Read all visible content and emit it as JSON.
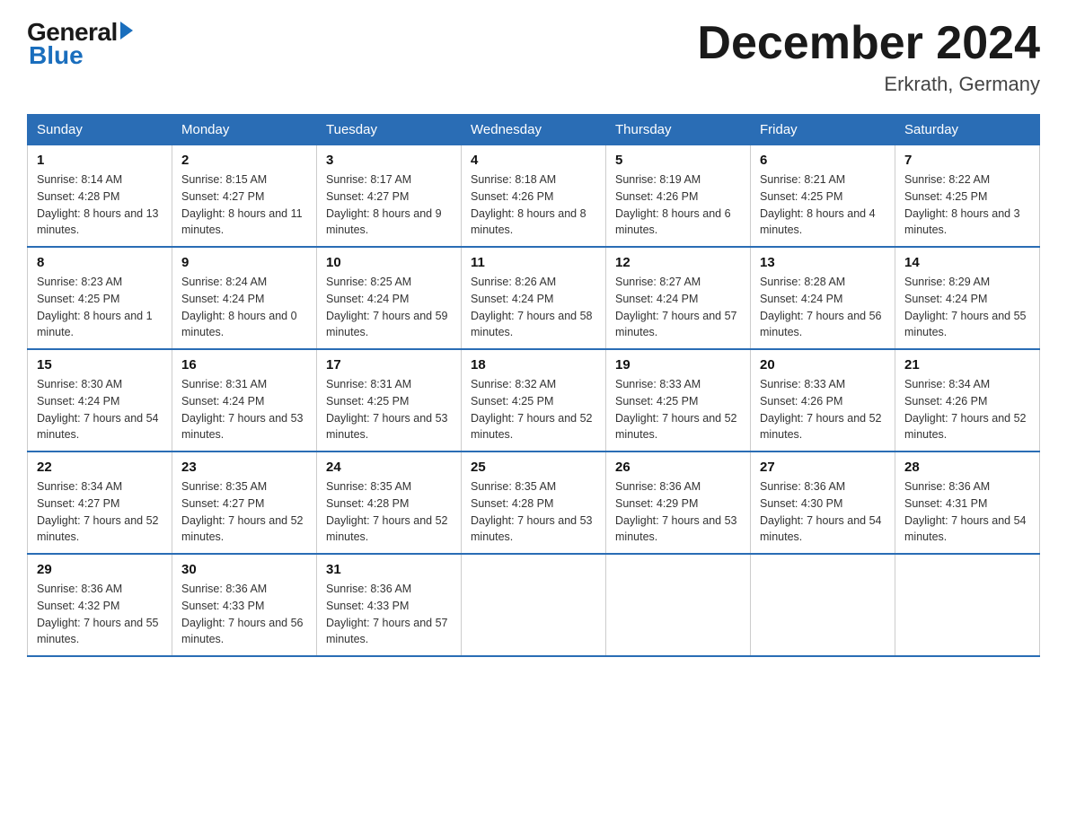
{
  "logo": {
    "general": "General",
    "blue": "Blue"
  },
  "title": {
    "month_year": "December 2024",
    "location": "Erkrath, Germany"
  },
  "headers": [
    "Sunday",
    "Monday",
    "Tuesday",
    "Wednesday",
    "Thursday",
    "Friday",
    "Saturday"
  ],
  "weeks": [
    [
      {
        "day": "1",
        "sunrise": "8:14 AM",
        "sunset": "4:28 PM",
        "daylight": "8 hours and 13 minutes."
      },
      {
        "day": "2",
        "sunrise": "8:15 AM",
        "sunset": "4:27 PM",
        "daylight": "8 hours and 11 minutes."
      },
      {
        "day": "3",
        "sunrise": "8:17 AM",
        "sunset": "4:27 PM",
        "daylight": "8 hours and 9 minutes."
      },
      {
        "day": "4",
        "sunrise": "8:18 AM",
        "sunset": "4:26 PM",
        "daylight": "8 hours and 8 minutes."
      },
      {
        "day": "5",
        "sunrise": "8:19 AM",
        "sunset": "4:26 PM",
        "daylight": "8 hours and 6 minutes."
      },
      {
        "day": "6",
        "sunrise": "8:21 AM",
        "sunset": "4:25 PM",
        "daylight": "8 hours and 4 minutes."
      },
      {
        "day": "7",
        "sunrise": "8:22 AM",
        "sunset": "4:25 PM",
        "daylight": "8 hours and 3 minutes."
      }
    ],
    [
      {
        "day": "8",
        "sunrise": "8:23 AM",
        "sunset": "4:25 PM",
        "daylight": "8 hours and 1 minute."
      },
      {
        "day": "9",
        "sunrise": "8:24 AM",
        "sunset": "4:24 PM",
        "daylight": "8 hours and 0 minutes."
      },
      {
        "day": "10",
        "sunrise": "8:25 AM",
        "sunset": "4:24 PM",
        "daylight": "7 hours and 59 minutes."
      },
      {
        "day": "11",
        "sunrise": "8:26 AM",
        "sunset": "4:24 PM",
        "daylight": "7 hours and 58 minutes."
      },
      {
        "day": "12",
        "sunrise": "8:27 AM",
        "sunset": "4:24 PM",
        "daylight": "7 hours and 57 minutes."
      },
      {
        "day": "13",
        "sunrise": "8:28 AM",
        "sunset": "4:24 PM",
        "daylight": "7 hours and 56 minutes."
      },
      {
        "day": "14",
        "sunrise": "8:29 AM",
        "sunset": "4:24 PM",
        "daylight": "7 hours and 55 minutes."
      }
    ],
    [
      {
        "day": "15",
        "sunrise": "8:30 AM",
        "sunset": "4:24 PM",
        "daylight": "7 hours and 54 minutes."
      },
      {
        "day": "16",
        "sunrise": "8:31 AM",
        "sunset": "4:24 PM",
        "daylight": "7 hours and 53 minutes."
      },
      {
        "day": "17",
        "sunrise": "8:31 AM",
        "sunset": "4:25 PM",
        "daylight": "7 hours and 53 minutes."
      },
      {
        "day": "18",
        "sunrise": "8:32 AM",
        "sunset": "4:25 PM",
        "daylight": "7 hours and 52 minutes."
      },
      {
        "day": "19",
        "sunrise": "8:33 AM",
        "sunset": "4:25 PM",
        "daylight": "7 hours and 52 minutes."
      },
      {
        "day": "20",
        "sunrise": "8:33 AM",
        "sunset": "4:26 PM",
        "daylight": "7 hours and 52 minutes."
      },
      {
        "day": "21",
        "sunrise": "8:34 AM",
        "sunset": "4:26 PM",
        "daylight": "7 hours and 52 minutes."
      }
    ],
    [
      {
        "day": "22",
        "sunrise": "8:34 AM",
        "sunset": "4:27 PM",
        "daylight": "7 hours and 52 minutes."
      },
      {
        "day": "23",
        "sunrise": "8:35 AM",
        "sunset": "4:27 PM",
        "daylight": "7 hours and 52 minutes."
      },
      {
        "day": "24",
        "sunrise": "8:35 AM",
        "sunset": "4:28 PM",
        "daylight": "7 hours and 52 minutes."
      },
      {
        "day": "25",
        "sunrise": "8:35 AM",
        "sunset": "4:28 PM",
        "daylight": "7 hours and 53 minutes."
      },
      {
        "day": "26",
        "sunrise": "8:36 AM",
        "sunset": "4:29 PM",
        "daylight": "7 hours and 53 minutes."
      },
      {
        "day": "27",
        "sunrise": "8:36 AM",
        "sunset": "4:30 PM",
        "daylight": "7 hours and 54 minutes."
      },
      {
        "day": "28",
        "sunrise": "8:36 AM",
        "sunset": "4:31 PM",
        "daylight": "7 hours and 54 minutes."
      }
    ],
    [
      {
        "day": "29",
        "sunrise": "8:36 AM",
        "sunset": "4:32 PM",
        "daylight": "7 hours and 55 minutes."
      },
      {
        "day": "30",
        "sunrise": "8:36 AM",
        "sunset": "4:33 PM",
        "daylight": "7 hours and 56 minutes."
      },
      {
        "day": "31",
        "sunrise": "8:36 AM",
        "sunset": "4:33 PM",
        "daylight": "7 hours and 57 minutes."
      },
      null,
      null,
      null,
      null
    ]
  ],
  "labels": {
    "sunrise": "Sunrise:",
    "sunset": "Sunset:",
    "daylight": "Daylight:"
  }
}
